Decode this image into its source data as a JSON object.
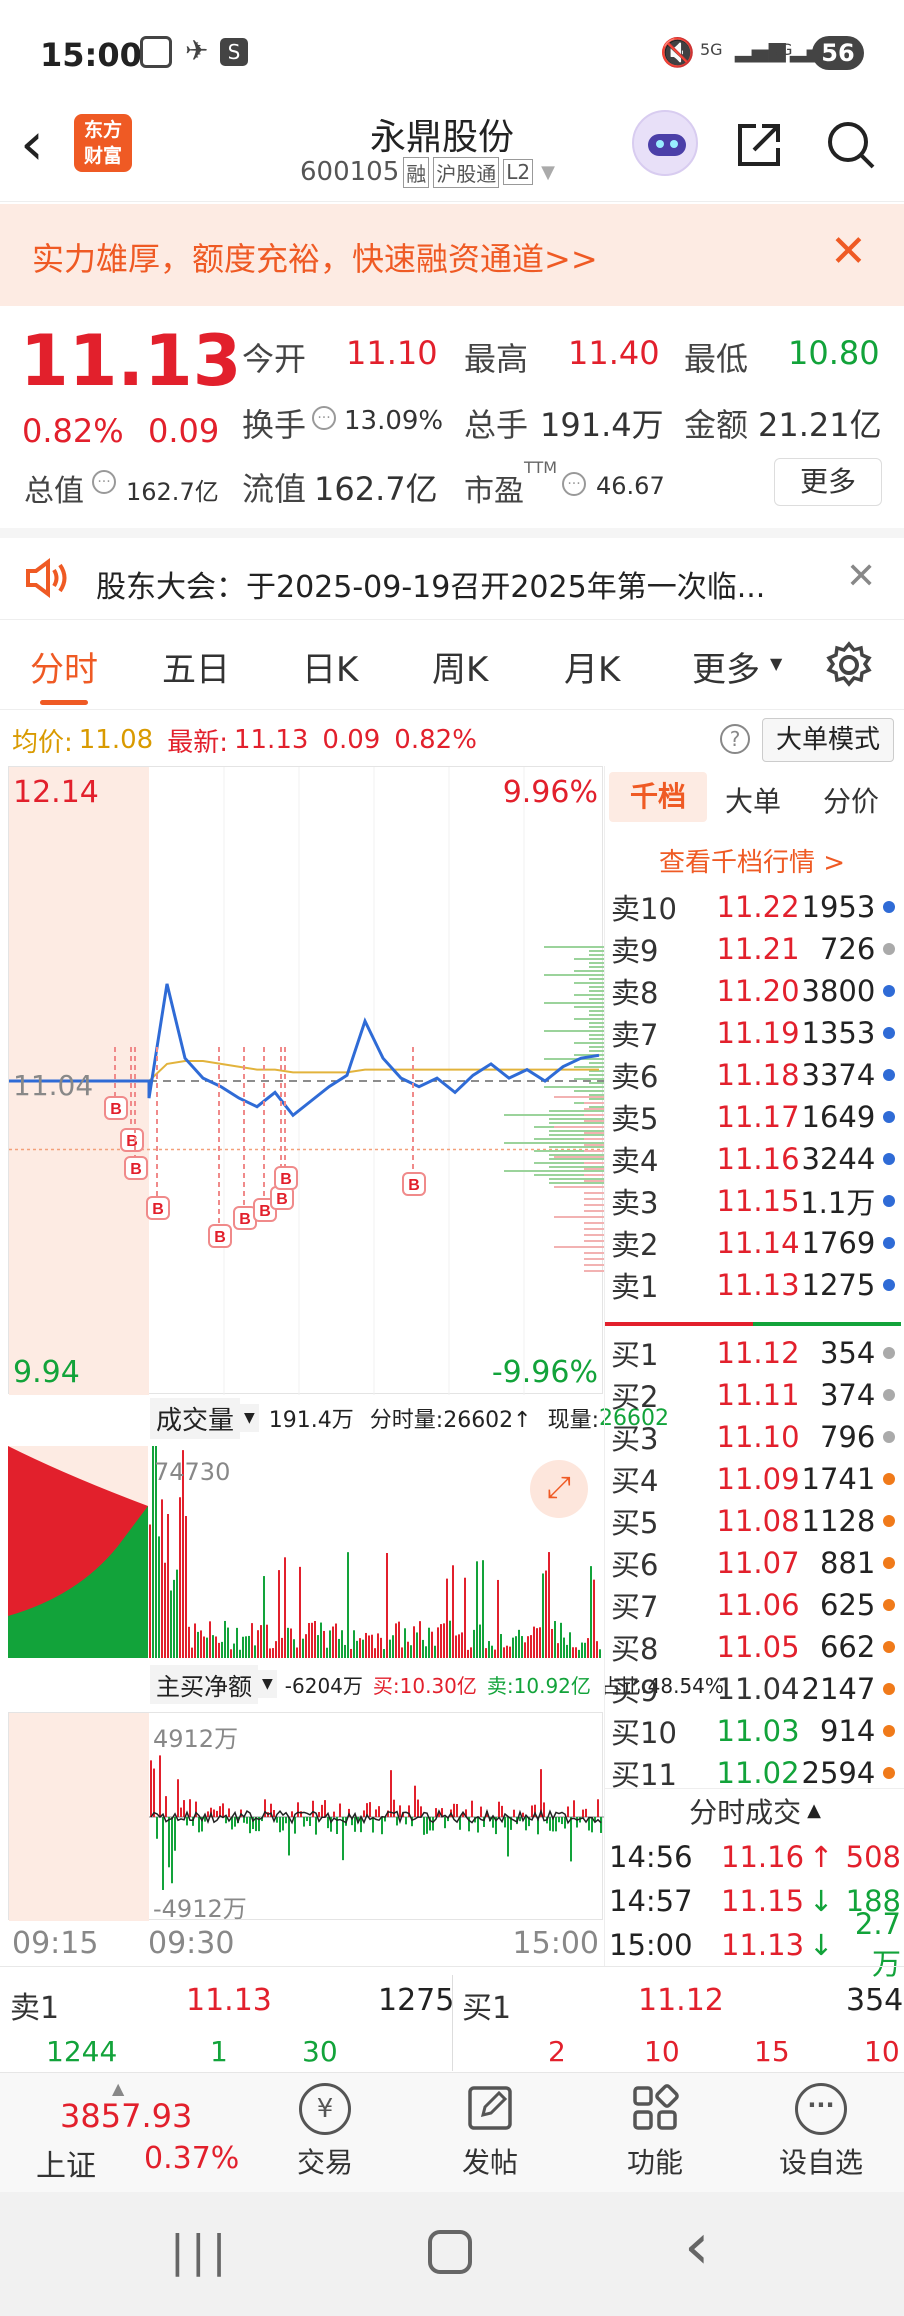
{
  "status_bar": {
    "time": "15:00",
    "battery": "56",
    "network_a": "5G",
    "network_b": "5G"
  },
  "header": {
    "logo_line1": "东方",
    "logo_line2": "财富",
    "stock_name": "永鼎股份",
    "stock_code": "600105",
    "tags": [
      "融",
      "沪股通",
      "L2"
    ]
  },
  "banner": {
    "text": "实力雄厚，额度充裕，快速融资通道>>"
  },
  "quote": {
    "price": "11.13",
    "change_pct": "0.82%",
    "change": "0.09",
    "open_label": "今开",
    "open": "11.10",
    "high_label": "最高",
    "high": "11.40",
    "low_label": "最低",
    "low": "10.80",
    "turnover_label": "换手",
    "turnover": "13.09%",
    "volume_label": "总手",
    "volume": "191.4万",
    "amount_label": "金额",
    "amount": "21.21亿",
    "mcap_label": "总值",
    "mcap": "162.7亿",
    "float_label": "流值",
    "float": "162.7亿",
    "pe_label": "市盈",
    "pe_sup": "TTM",
    "pe": "46.67",
    "more_btn": "更多"
  },
  "notice": {
    "text": "股东大会：于2025-09-19召开2025年第一次临..."
  },
  "tabs": [
    "分时",
    "五日",
    "日K",
    "周K",
    "月K",
    "更多"
  ],
  "chart_info": {
    "avg_label": "均价:",
    "avg": "11.08",
    "latest_label": "最新:",
    "latest": "11.13",
    "chg": "0.09",
    "pct": "0.82%",
    "mode_btn": "大单模式"
  },
  "right_tabs": [
    "千档",
    "大单",
    "分价"
  ],
  "right_link": "查看千档行情 >",
  "asks": [
    {
      "n": "卖10",
      "p": "11.22",
      "v": "1953",
      "c": "#2f6bd6"
    },
    {
      "n": "卖9",
      "p": "11.21",
      "v": "726",
      "c": "#aaaaaa"
    },
    {
      "n": "卖8",
      "p": "11.20",
      "v": "3800",
      "c": "#2f6bd6"
    },
    {
      "n": "卖7",
      "p": "11.19",
      "v": "1353",
      "c": "#2f6bd6"
    },
    {
      "n": "卖6",
      "p": "11.18",
      "v": "3374",
      "c": "#2f6bd6"
    },
    {
      "n": "卖5",
      "p": "11.17",
      "v": "1649",
      "c": "#2f6bd6"
    },
    {
      "n": "卖4",
      "p": "11.16",
      "v": "3244",
      "c": "#2f6bd6"
    },
    {
      "n": "卖3",
      "p": "11.15",
      "v": "1.1万",
      "c": "#2f6bd6"
    },
    {
      "n": "卖2",
      "p": "11.14",
      "v": "1769",
      "c": "#2f6bd6"
    },
    {
      "n": "卖1",
      "p": "11.13",
      "v": "1275",
      "c": "#2f6bd6"
    }
  ],
  "bids": [
    {
      "n": "买1",
      "p": "11.12",
      "v": "354",
      "c": "#aaaaaa"
    },
    {
      "n": "买2",
      "p": "11.11",
      "v": "374",
      "c": "#aaaaaa"
    },
    {
      "n": "买3",
      "p": "11.10",
      "v": "796",
      "c": "#aaaaaa"
    },
    {
      "n": "买4",
      "p": "11.09",
      "v": "1741",
      "c": "#f07a1a"
    },
    {
      "n": "买5",
      "p": "11.08",
      "v": "1128",
      "c": "#f07a1a"
    },
    {
      "n": "买6",
      "p": "11.07",
      "v": "881",
      "c": "#f07a1a"
    },
    {
      "n": "买7",
      "p": "11.06",
      "v": "625",
      "c": "#f07a1a"
    },
    {
      "n": "买8",
      "p": "11.05",
      "v": "662",
      "c": "#f07a1a"
    },
    {
      "n": "买9",
      "p": "11.04",
      "v": "2147",
      "c": "#f07a1a"
    },
    {
      "n": "买10",
      "p": "11.03",
      "v": "914",
      "c": "#f07a1a"
    },
    {
      "n": "买11",
      "p": "11.02",
      "v": "2594",
      "c": "#f07a1a"
    }
  ],
  "ticks_title": "分时成交",
  "ticks": [
    {
      "t": "14:56",
      "p": "11.16",
      "arrow": "↑",
      "v": "508"
    },
    {
      "t": "14:57",
      "p": "11.15",
      "arrow": "↓",
      "v": "188"
    },
    {
      "t": "15:00",
      "p": "11.13",
      "arrow": "↓",
      "v": "2.7万"
    }
  ],
  "price_axis": {
    "top": "12.14",
    "bottom": "9.94",
    "mid": "11.04",
    "top_pct": "9.96%",
    "bottom_pct": "-9.96%"
  },
  "volume_panel": {
    "label": "成交量",
    "total": "191.4万",
    "split": "分时量:26602↑",
    "now_label": "现量:",
    "now": "26602",
    "max": "74730"
  },
  "flow_panel": {
    "label": "主买净额",
    "net": "-6204万",
    "buy": "买:10.30亿",
    "sell": "卖:10.92亿",
    "ratio": "占比:48.54%",
    "max": "4912万",
    "min": "-4912万"
  },
  "time_axis": [
    "09:15",
    "09:30",
    "15:00"
  ],
  "bottom_row": {
    "sell_label": "卖1",
    "sell_price": "11.13",
    "sell_vol": "1275",
    "buy_label": "买1",
    "buy_price": "11.12",
    "buy_vol": "354",
    "left_nums": [
      "1244",
      "1",
      "30"
    ],
    "right_nums": [
      "2",
      "10",
      "15",
      "10"
    ]
  },
  "index": {
    "value": "3857.93",
    "name": "上证",
    "pct": "0.37%"
  },
  "nav": [
    "交易",
    "发帖",
    "功能",
    "设自选"
  ],
  "chart_data": {
    "type": "line",
    "x_range": [
      "09:15",
      "15:00"
    ],
    "ylim": [
      9.94,
      12.14
    ],
    "prev_close": 11.04,
    "series": [
      {
        "name": "最新",
        "values": [
          11.04,
          11.04,
          11.04,
          10.98,
          11.38,
          11.12,
          11.05,
          11.02,
          10.98,
          10.95,
          11.0,
          10.92,
          10.97,
          11.02,
          11.06,
          11.25,
          11.12,
          11.05,
          11.02,
          11.05,
          11.0,
          11.06,
          11.1,
          11.05,
          11.08,
          11.04,
          11.09,
          11.12,
          11.13
        ]
      },
      {
        "name": "均价",
        "values": [
          11.04,
          11.04,
          11.04,
          11.04,
          11.1,
          11.11,
          11.11,
          11.1,
          11.09,
          11.08,
          11.08,
          11.07,
          11.07,
          11.07,
          11.07,
          11.08,
          11.08,
          11.08,
          11.08,
          11.08,
          11.08,
          11.08,
          11.08,
          11.08,
          11.08,
          11.08,
          11.08,
          11.08,
          11.08
        ]
      }
    ]
  }
}
